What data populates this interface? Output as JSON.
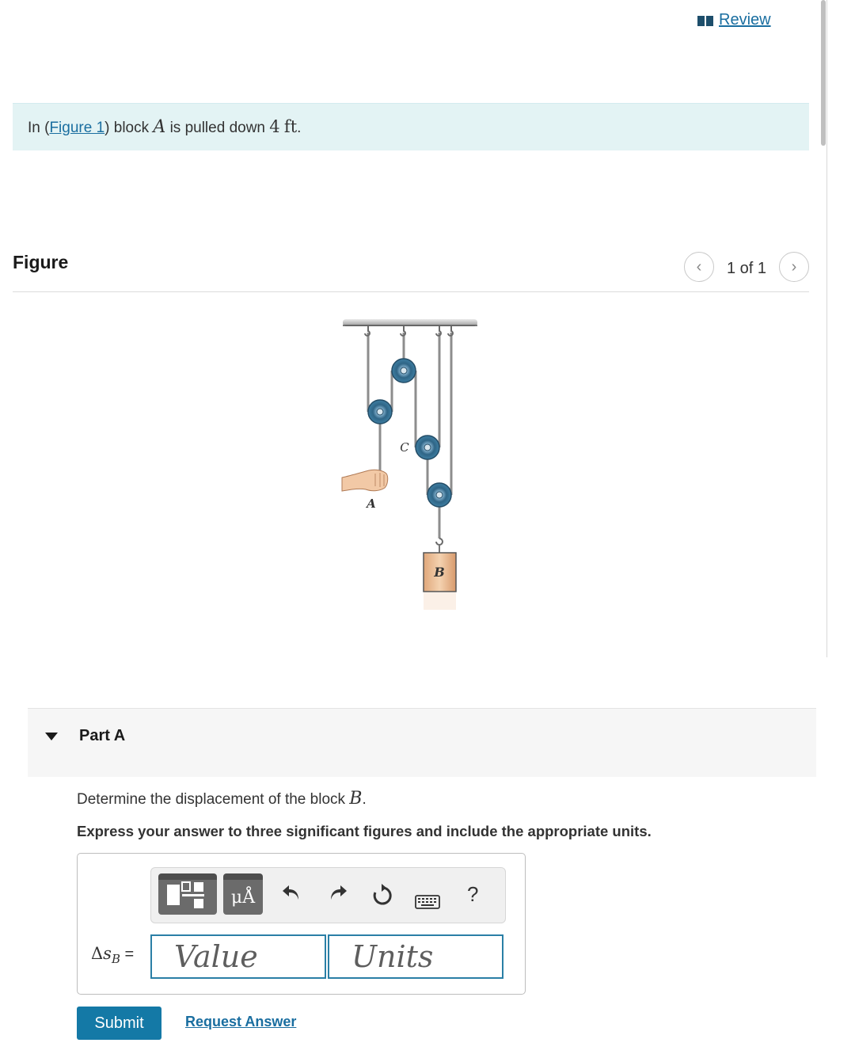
{
  "header": {
    "review_label": "Review"
  },
  "intro": {
    "prefix": "In (",
    "figure_link": "Figure 1",
    "mid": ") block ",
    "block": "A",
    "middle": " is pulled down ",
    "distance": "4",
    "unit": "ft",
    "end": "."
  },
  "figure": {
    "title": "Figure",
    "pager": "1 of 1",
    "labels": {
      "a": "A",
      "b": "B",
      "c": "C"
    }
  },
  "part": {
    "title": "Part A",
    "question_prefix": "Determine the displacement of the block ",
    "question_var": "B",
    "question_end": ".",
    "instruction": "Express your answer to three significant figures and include the appropriate units.",
    "input_label_delta": "Δ",
    "input_label_s": "s",
    "input_label_sub": "B",
    "input_label_eq": " =",
    "value_placeholder": "Value",
    "units_placeholder": "Units",
    "units_button": "μÅ",
    "help": "?",
    "submit": "Submit",
    "request_answer": "Request Answer"
  },
  "colors": {
    "accent": "#1479a6",
    "link": "#1a6ea0",
    "intro_bg": "#e3f3f4"
  }
}
